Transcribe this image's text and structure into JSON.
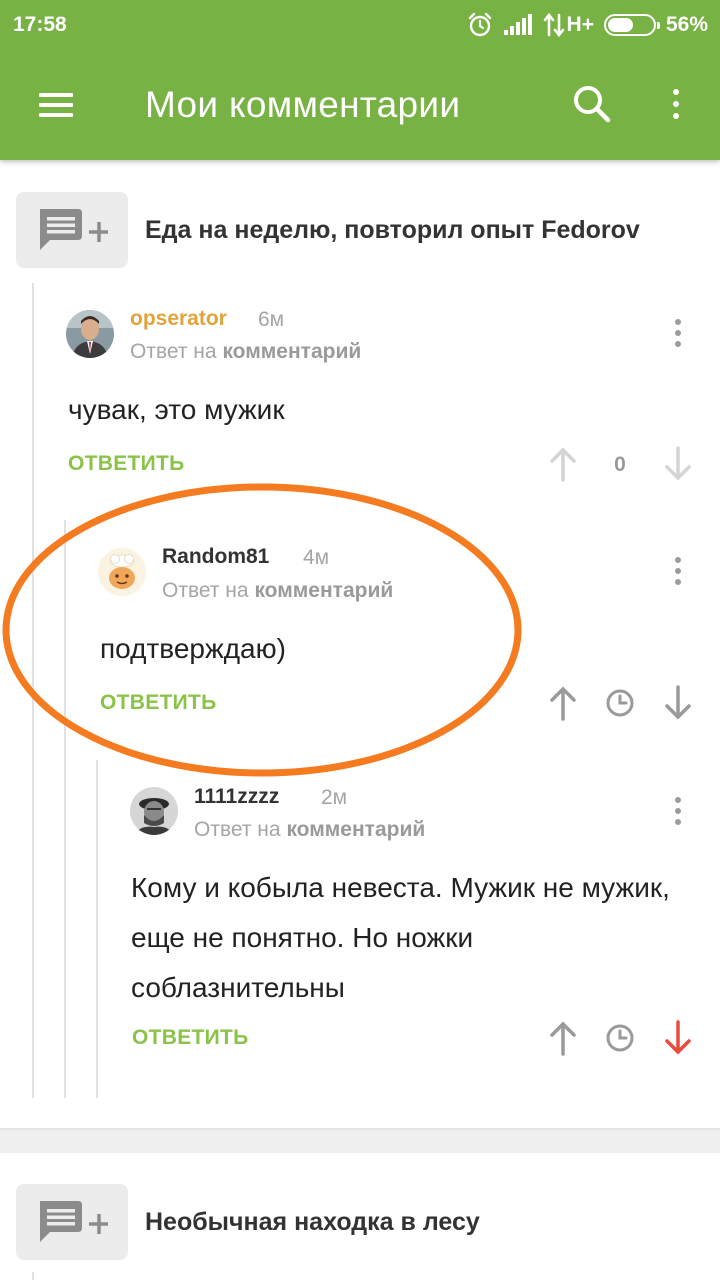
{
  "status_bar": {
    "time": "17:58",
    "network": "H+",
    "battery_percent": "56%",
    "battery_level": 0.56
  },
  "appbar": {
    "title": "Мои комментарии",
    "menu_icon": "hamburger-menu-icon",
    "search_icon": "search-icon",
    "more_icon": "more-vert-icon",
    "color": "#78b244"
  },
  "stories": [
    {
      "title": "Еда на неделю, повторил опыт Fedorov",
      "icon": "comment-add-icon"
    },
    {
      "title": "Необычная находка в лесу",
      "icon": "comment-add-icon"
    }
  ],
  "comments": [
    {
      "author": "opserator",
      "author_color": "#e0a43a",
      "time": "6м",
      "reply_prefix": "Ответ на",
      "reply_target": "комментарий",
      "text": "чувак, это мужик",
      "reply_label": "ОТВЕТИТЬ",
      "rating": "0"
    },
    {
      "author": "Random81",
      "author_color": "#333333",
      "time": "4м",
      "reply_prefix": "Ответ на",
      "reply_target": "комментарий",
      "text": "подтверждаю)",
      "reply_label": "ОТВЕТИТЬ"
    },
    {
      "author": "1111zzzz",
      "author_color": "#333333",
      "time": "2м",
      "reply_prefix": "Ответ на",
      "reply_target": "комментарий",
      "text": "Кому и кобыла невеста. Мужик не мужик, еще не понятно. Но ножки соблазнительны",
      "reply_label": "ОТВЕТИТЬ",
      "downvote_active_color": "#e84c3d"
    }
  ],
  "colors": {
    "accent_green": "#8bc34a",
    "annotation_orange": "#f47b20",
    "thread_line": "#e1e1e1"
  }
}
